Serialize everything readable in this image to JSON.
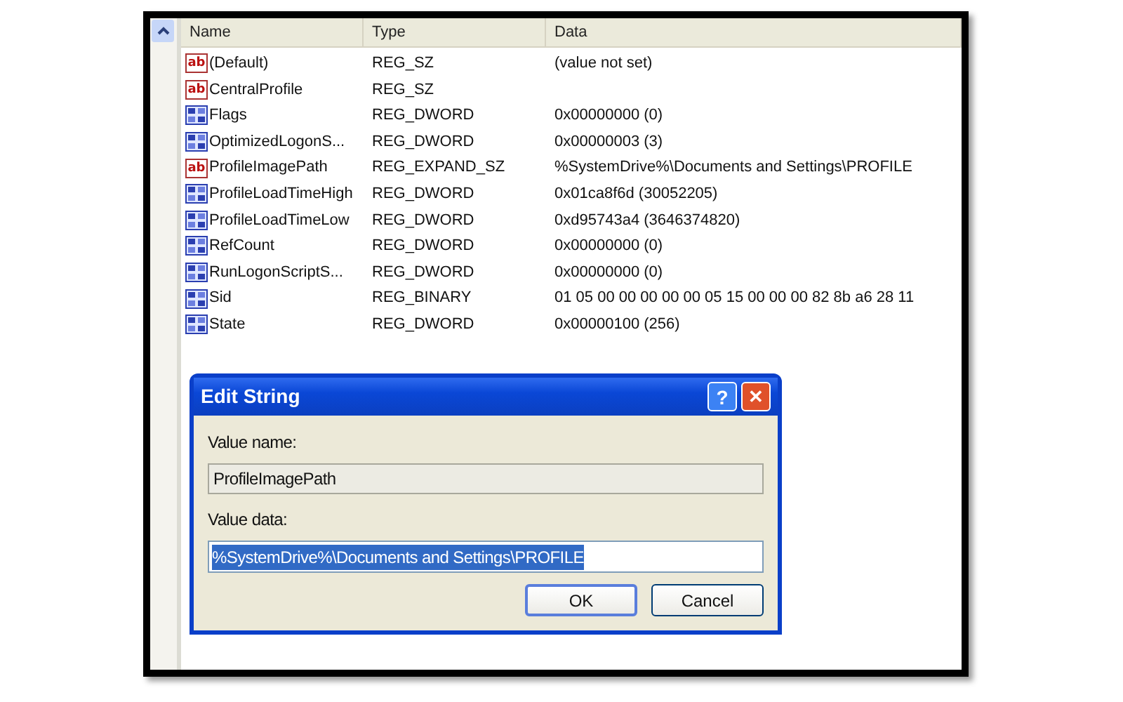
{
  "list": {
    "columns": [
      "Name",
      "Type",
      "Data"
    ],
    "rows": [
      {
        "kind": "string",
        "icon_text": "ab",
        "name": "(Default)",
        "type": "REG_SZ",
        "data": "(value not set)"
      },
      {
        "kind": "string",
        "icon_text": "ab",
        "name": "CentralProfile",
        "type": "REG_SZ"
      },
      {
        "kind": "binary",
        "name": "Flags",
        "type": "REG_DWORD",
        "data": "0x00000000 (0)"
      },
      {
        "kind": "binary",
        "name": "OptimizedLogonS...",
        "type": "REG_DWORD",
        "data": "0x00000003 (3)"
      },
      {
        "kind": "string",
        "icon_text": "ab",
        "name": "ProfileImagePath",
        "type": "REG_EXPAND_SZ",
        "data": "%SystemDrive%\\Documents and Settings\\PROFILE"
      },
      {
        "kind": "binary",
        "name": "ProfileLoadTimeHigh",
        "type": "REG_DWORD",
        "data": "0x01ca8f6d (30052205)"
      },
      {
        "kind": "binary",
        "name": "ProfileLoadTimeLow",
        "type": "REG_DWORD",
        "data": "0xd95743a4 (3646374820)"
      },
      {
        "kind": "binary",
        "name": "RefCount",
        "type": "REG_DWORD",
        "data": "0x00000000 (0)"
      },
      {
        "kind": "binary",
        "name": "RunLogonScriptS...",
        "type": "REG_DWORD",
        "data": "0x00000000 (0)"
      },
      {
        "kind": "binary",
        "name": "Sid",
        "type": "REG_BINARY",
        "data": "01 05 00 00 00 00 00 05 15 00 00 00 82 8b a6 28 11"
      },
      {
        "kind": "binary",
        "name": "State",
        "type": "REG_DWORD",
        "data": "0x00000100 (256)"
      }
    ]
  },
  "dialog": {
    "title": "Edit String",
    "help": "?",
    "close": "✕",
    "name_label": "Value name:",
    "name_value": "ProfileImagePath",
    "data_label": "Value data:",
    "data_value": "%SystemDrive%\\Documents and Settings\\PROFILE",
    "data_selected": true,
    "buttons": [
      {
        "label": "OK",
        "default": true
      },
      {
        "label": "Cancel",
        "default": false
      }
    ]
  }
}
